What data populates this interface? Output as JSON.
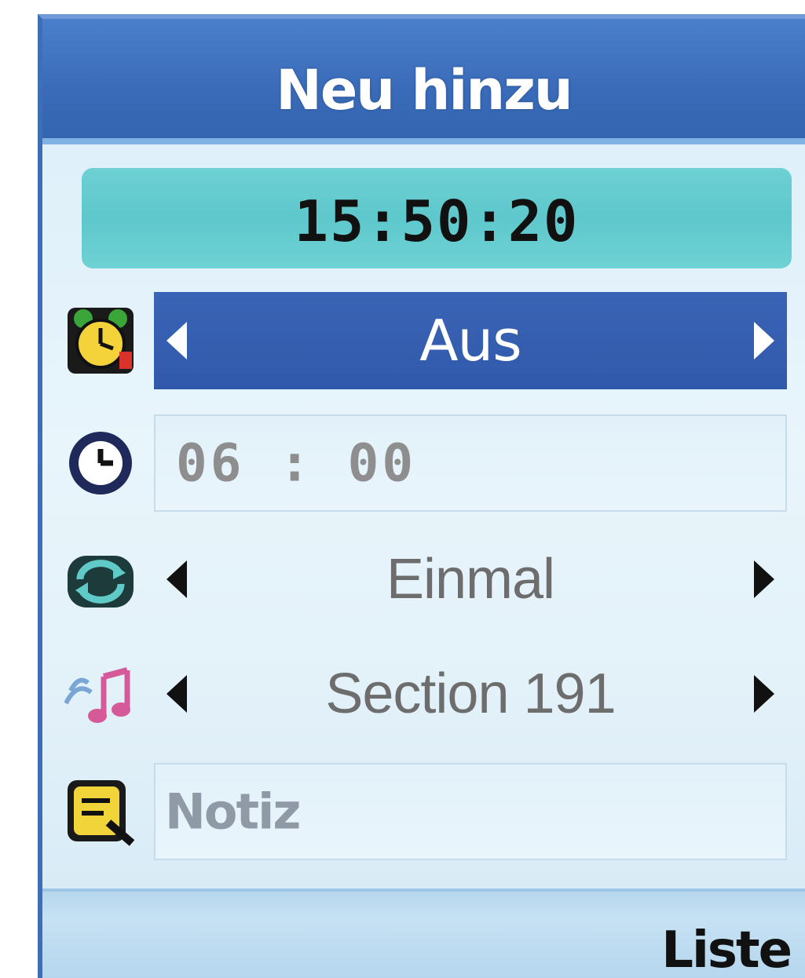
{
  "header": {
    "title": "Neu hinzu"
  },
  "clock": {
    "current_time": "15:50:20"
  },
  "form": {
    "alarm_state": {
      "icon": "alarm-clock-icon",
      "value": "Aus"
    },
    "alarm_time": {
      "icon": "clock-icon",
      "value": "06 : 00"
    },
    "repeat": {
      "icon": "repeat-icon",
      "value": "Einmal"
    },
    "melody": {
      "icon": "music-note-icon",
      "value": "Section 191"
    },
    "note": {
      "icon": "memo-icon",
      "placeholder": "Notiz"
    }
  },
  "softkeys": {
    "right_label": "Liste"
  },
  "colors": {
    "title_bar": "#3a6bb8",
    "clock_bar": "#5ec8cc",
    "selected_row": "#3159ab",
    "background": "#e3f1f9"
  }
}
